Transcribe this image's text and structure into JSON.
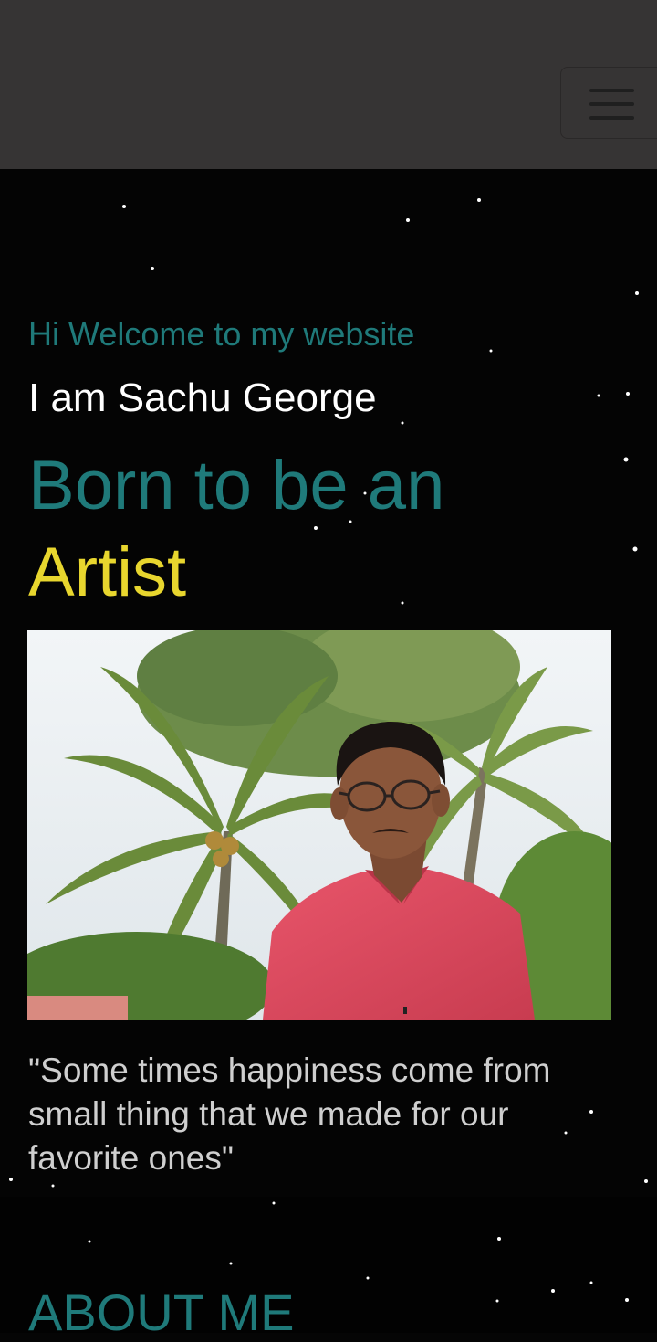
{
  "navbar": {
    "menu_icon": "hamburger-menu-icon"
  },
  "hero": {
    "welcome": "Hi Welcome to my website",
    "name": "I am Sachu George",
    "tagline": "Born to be an",
    "role": "Artist",
    "quote": "\"Some times happiness come from small thing that we made for our favorite ones\""
  },
  "about": {
    "title": "ABOUT ME"
  },
  "colors": {
    "accent": "#1f7a7a",
    "highlight": "#e8d62e",
    "navbar_bg": "#363434",
    "page_bg": "#050505"
  }
}
